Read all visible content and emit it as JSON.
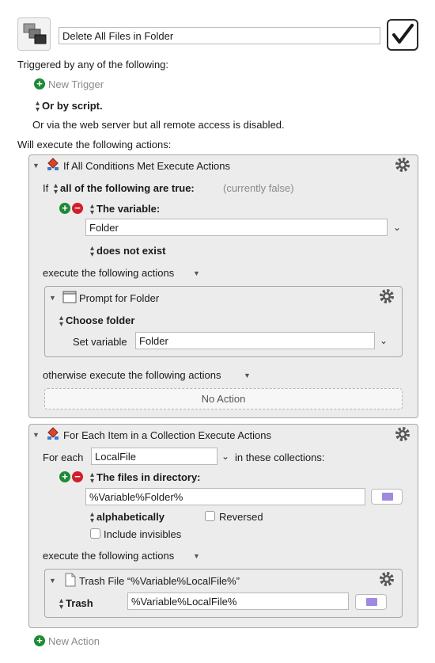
{
  "macro": {
    "name": "Delete All Files in Folder",
    "enabled_checked": true
  },
  "triggers": {
    "heading": "Triggered by any of the following:",
    "new_trigger": "New Trigger",
    "or_by_script": "Or by script.",
    "web_server": "Or via the web server but all remote access is disabled."
  },
  "actions_heading": "Will execute the following actions:",
  "if_action": {
    "title": "If All Conditions Met Execute Actions",
    "if_label": "If",
    "condition_mode": "all of the following are true:",
    "state": "(currently false)",
    "condition_type": "The variable:",
    "variable_value": "Folder",
    "test": "does not exist",
    "execute_label": "execute the following actions",
    "otherwise_label": "otherwise execute the following actions",
    "no_action": "No Action",
    "prompt": {
      "title": "Prompt for Folder",
      "choose": "Choose folder",
      "set_variable_label": "Set variable",
      "set_variable_value": "Folder"
    }
  },
  "for_each_action": {
    "title": "For Each Item in a Collection Execute Actions",
    "for_each_label": "For each",
    "variable_value": "LocalFile",
    "collections_label": "in these collections:",
    "collection_type": "The files in directory:",
    "directory_value": "%Variable%Folder%",
    "sort": "alphabetically",
    "reversed_label": "Reversed",
    "include_invisibles_label": "Include invisibles",
    "execute_label": "execute the following actions",
    "trash": {
      "title": "Trash File “%Variable%LocalFile%”",
      "trash_label": "Trash",
      "path_value": "%Variable%LocalFile%"
    }
  },
  "new_action": "New Action",
  "colors": {
    "add": "#1e8a35",
    "remove": "#d21e2b",
    "panel": "#ececec",
    "folder_icon": "#9f8ae0"
  }
}
